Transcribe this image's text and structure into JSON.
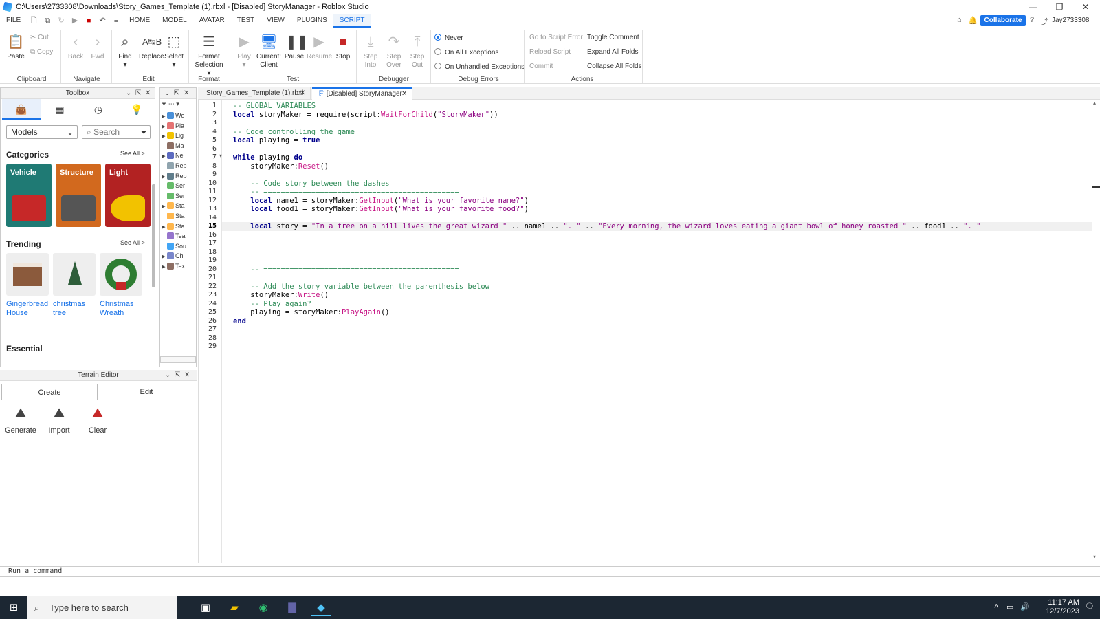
{
  "window": {
    "title": "C:\\Users\\2733308\\Downloads\\Story_Games_Template (1).rbxl - [Disabled] StoryManager - Roblox Studio"
  },
  "menu": [
    "FILE",
    "HOME",
    "MODEL",
    "AVATAR",
    "TEST",
    "VIEW",
    "PLUGINS",
    "SCRIPT"
  ],
  "topright": {
    "collaborate": "Collaborate",
    "user": "Jay2733308"
  },
  "ribbon": {
    "paste": "Paste",
    "cut": "Cut",
    "copy": "Copy",
    "clipboard": "Clipboard",
    "back": "Back",
    "fwd": "Fwd",
    "navigate": "Navigate",
    "find": "Find",
    "replace": "Replace",
    "select": "Select",
    "edit": "Edit",
    "format_selection_1": "Format",
    "format_selection_2": "Selection",
    "format": "Format",
    "play": "Play",
    "current_client_1": "Current:",
    "current_client_2": "Client",
    "pause": "Pause",
    "resume": "Resume",
    "stop": "Stop",
    "test": "Test",
    "step_into_1": "Step",
    "step_into_2": "Into",
    "step_over_1": "Step",
    "step_over_2": "Over",
    "step_out_1": "Step",
    "step_out_2": "Out",
    "debugger": "Debugger",
    "never": "Never",
    "on_all_exceptions": "On All Exceptions",
    "on_unhandled_exceptions": "On Unhandled Exceptions",
    "debug_errors": "Debug Errors",
    "go_to_script_error": "Go to Script Error",
    "reload_script": "Reload Script",
    "commit": "Commit",
    "toggle_comment": "Toggle Comment",
    "expand_all_folds": "Expand All Folds",
    "collapse_all_folds": "Collapse All Folds",
    "actions": "Actions"
  },
  "toolbox": {
    "title": "Toolbox",
    "dropdown": "Models",
    "search_placeholder": "Search",
    "categories_label": "Categories",
    "see_all": "See All >",
    "categories": [
      {
        "name": "Vehicle",
        "color": "#1f7a74"
      },
      {
        "name": "Structure",
        "color": "#d2691e"
      },
      {
        "name": "Light",
        "color": "#b22222"
      }
    ],
    "trending_label": "Trending",
    "trending": [
      {
        "line1": "Gingerbread",
        "line2": "House"
      },
      {
        "line1": "christmas",
        "line2": "tree"
      },
      {
        "line1": "Christmas",
        "line2": "Wreath"
      }
    ],
    "essential_label": "Essential"
  },
  "explorer": {
    "rows": [
      "Wo",
      "Pla",
      "Lig",
      "Ma",
      "Ne",
      "Rep",
      "Rep",
      "Ser",
      "Ser",
      "Sta",
      "Sta",
      "Sta",
      "Tea",
      "Sou",
      "Ch",
      "Tex"
    ]
  },
  "terrain": {
    "title": "Terrain Editor",
    "tab_create": "Create",
    "tab_edit": "Edit",
    "generate": "Generate",
    "import": "Import",
    "clear": "Clear"
  },
  "tabs": {
    "file": "Story_Games_Template (1).rbxl",
    "script": "[Disabled] StoryManager"
  },
  "code": {
    "current_line": 15,
    "lines": [
      "-- GLOBAL VARIABLES",
      "local storyMaker = require(script:WaitForChild(\"StoryMaker\"))",
      "",
      "-- Code controlling the game",
      "local playing = true",
      "",
      "while playing do",
      "    storyMaker:Reset()",
      "",
      "    -- Code story between the dashes",
      "    -- =============================================",
      "    local name1 = storyMaker:GetInput(\"What is your favorite name?\")",
      "    local food1 = storyMaker:GetInput(\"What is your favorite food?\")",
      "",
      "    local story = \"In a tree on a hill lives the great wizard \" .. name1 .. \". \" .. \"Every morning, the wizard loves eating a giant bowl of honey roasted \" .. food1 .. \". \"",
      "",
      "",
      "",
      "",
      "    -- =============================================",
      "",
      "    -- Add the story variable between the parenthesis below",
      "    storyMaker:Write()",
      "    -- Play again?",
      "    playing = storyMaker:PlayAgain()",
      "end",
      "",
      "",
      ""
    ]
  },
  "command": {
    "placeholder": "Run a command"
  },
  "taskbar": {
    "search": "Type here to search",
    "time": "11:17 AM",
    "date": "12/7/2023"
  }
}
